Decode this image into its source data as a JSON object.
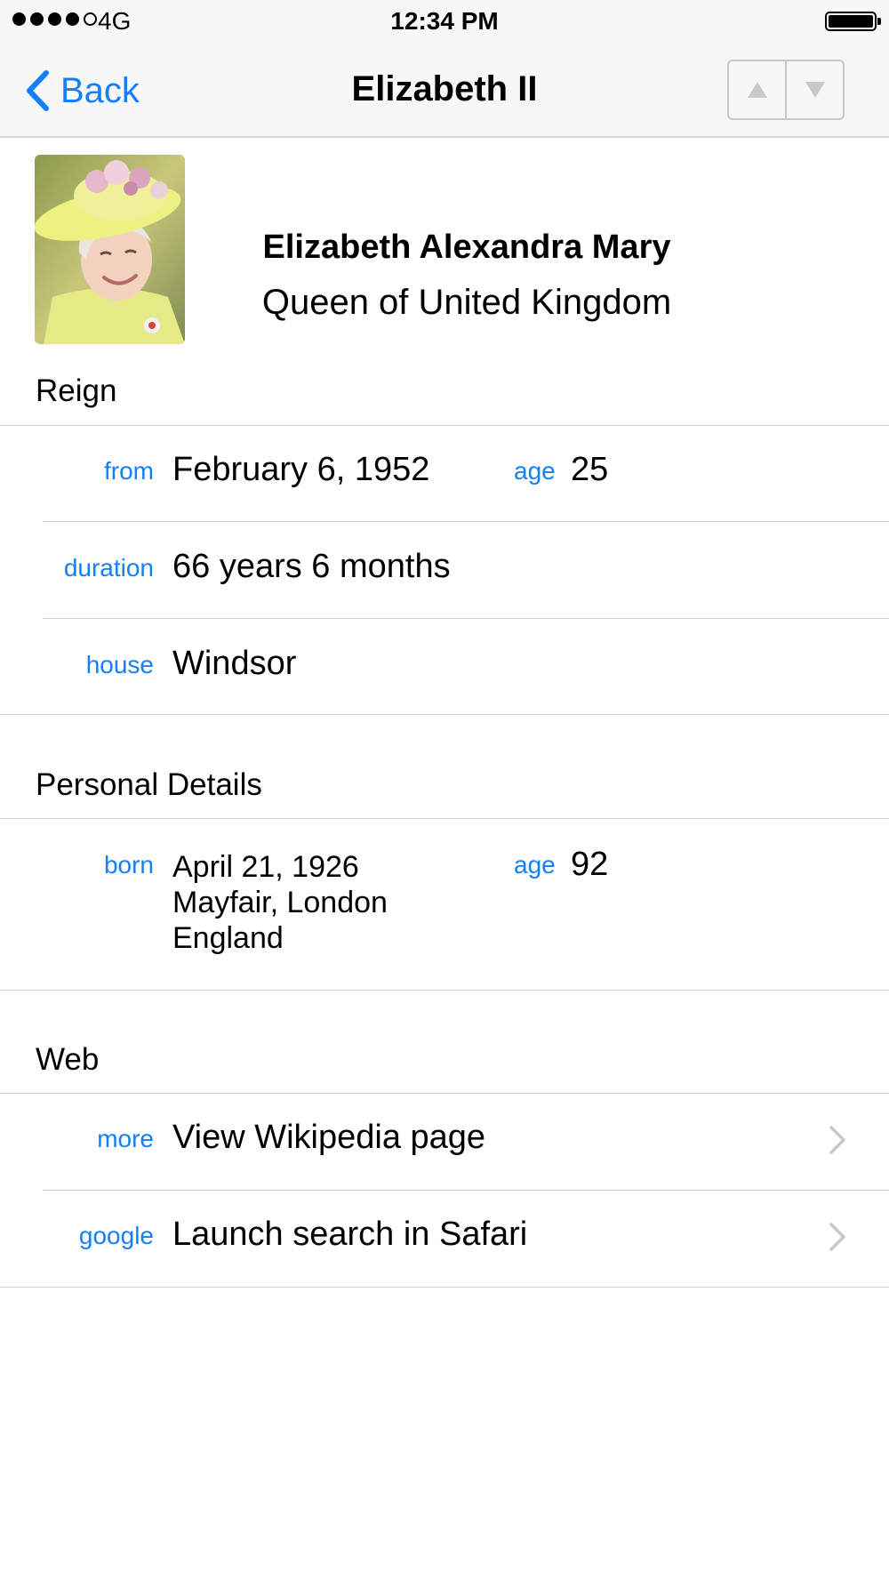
{
  "status_bar": {
    "carrier": "4G",
    "time": "12:34 PM"
  },
  "nav": {
    "back_label": "Back",
    "title": "Elizabeth II"
  },
  "header": {
    "full_name": "Elizabeth Alexandra Mary",
    "role": "Queen of United Kingdom"
  },
  "reign": {
    "section_title": "Reign",
    "from_label": "from",
    "from_value": "February 6, 1952",
    "age_label": "age",
    "age_value": "25",
    "duration_label": "duration",
    "duration_value": "66 years 6 months",
    "house_label": "house",
    "house_value": "Windsor"
  },
  "personal": {
    "section_title": "Personal Details",
    "born_label": "born",
    "born_date": "April 21, 1926",
    "born_place1": "Mayfair, London",
    "born_place2": "England",
    "age_label": "age",
    "age_value": "92"
  },
  "web": {
    "section_title": "Web",
    "more_label": "more",
    "more_value": "View Wikipedia page",
    "google_label": "google",
    "google_value": "Launch search in Safari"
  },
  "colors": {
    "accent": "#147efb",
    "nav_background": "#f7f7f7",
    "separator": "#d0d0d0"
  },
  "icons": {
    "back": "chevron-left-icon",
    "previous": "triangle-up-icon",
    "next": "triangle-down-icon",
    "disclosure": "chevron-right-icon"
  }
}
